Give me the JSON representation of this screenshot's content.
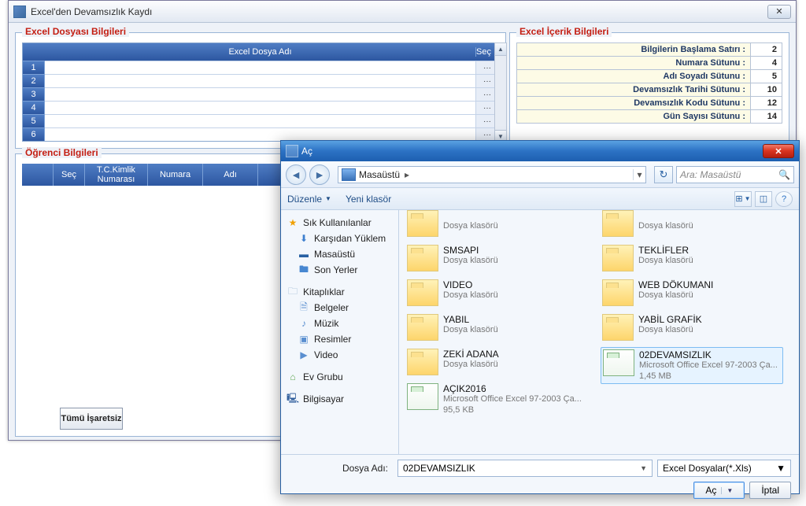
{
  "bg": {
    "title": "Excel'den Devamsızlık Kaydı",
    "group_excel_title": "Excel Dosyası Bilgileri",
    "group_content_title": "Excel İçerik Bilgileri",
    "group_ogrenci_title": "Öğrenci Bilgileri",
    "excel_header_file": "Excel Dosya Adı",
    "excel_header_sec": "Seç",
    "excel_rows": [
      "1",
      "2",
      "3",
      "4",
      "5",
      "6"
    ],
    "config": [
      {
        "label": "Bilgilerin Başlama Satırı :",
        "value": "2"
      },
      {
        "label": "Numara Sütunu :",
        "value": "4"
      },
      {
        "label": "Adı Soyadı Sütunu :",
        "value": "5"
      },
      {
        "label": "Devamsızlık Tarihi Sütunu :",
        "value": "10"
      },
      {
        "label": "Devamsızlık Kodu Sütunu :",
        "value": "12"
      },
      {
        "label": "Gün Sayısı Sütunu :",
        "value": "14"
      }
    ],
    "og_headers": {
      "c2": "Seç",
      "c3": "T.C.Kimlik Numarası",
      "c4": "Numara",
      "c5": "Adı"
    },
    "btn_tumu": "Tümü İşaretsiz"
  },
  "dlg": {
    "title": "Aç",
    "crumb": "Masaüstü",
    "search_placeholder": "Ara: Masaüstü",
    "tool_organize": "Düzenle",
    "tool_newfolder": "Yeni klasör",
    "sidebar": {
      "fav": "Sık Kullanılanlar",
      "downloads": "Karşıdan Yüklem",
      "desktop": "Masaüstü",
      "recent": "Son Yerler",
      "libraries": "Kitaplıklar",
      "documents": "Belgeler",
      "music": "Müzik",
      "pictures": "Resimler",
      "videos": "Video",
      "homegroup": "Ev Grubu",
      "computer": "Bilgisayar"
    },
    "top_row": {
      "left": {
        "sub": "Dosya klasörü"
      },
      "right": {
        "sub": "Dosya klasörü"
      }
    },
    "files_left": [
      {
        "name": "SMSAPI",
        "sub": "Dosya klasörü",
        "type": "folder"
      },
      {
        "name": "VIDEO",
        "sub": "Dosya klasörü",
        "type": "folder"
      },
      {
        "name": "YABIL",
        "sub": "Dosya klasörü",
        "type": "folder"
      },
      {
        "name": "ZEKİ ADANA",
        "sub": "Dosya klasörü",
        "type": "folder"
      },
      {
        "name": "AÇIK2016",
        "sub": "Microsoft Office Excel 97-2003 Ça...",
        "sub2": "95,5 KB",
        "type": "excel"
      }
    ],
    "files_right": [
      {
        "name": "TEKLİFLER",
        "sub": "Dosya klasörü",
        "type": "folder"
      },
      {
        "name": "WEB DÖKUMANI",
        "sub": "Dosya klasörü",
        "type": "folder"
      },
      {
        "name": "YABİL GRAFİK",
        "sub": "Dosya klasörü",
        "type": "folder"
      },
      {
        "name": "02DEVAMSIZLIK",
        "sub": "Microsoft Office Excel 97-2003 Ça...",
        "sub2": "1,45 MB",
        "type": "excel",
        "selected": true
      }
    ],
    "file_name_label": "Dosya Adı:",
    "file_name_value": "02DEVAMSIZLIK",
    "file_type": "Excel Dosyalar(*.Xls)",
    "btn_open": "Aç",
    "btn_cancel": "İptal"
  }
}
